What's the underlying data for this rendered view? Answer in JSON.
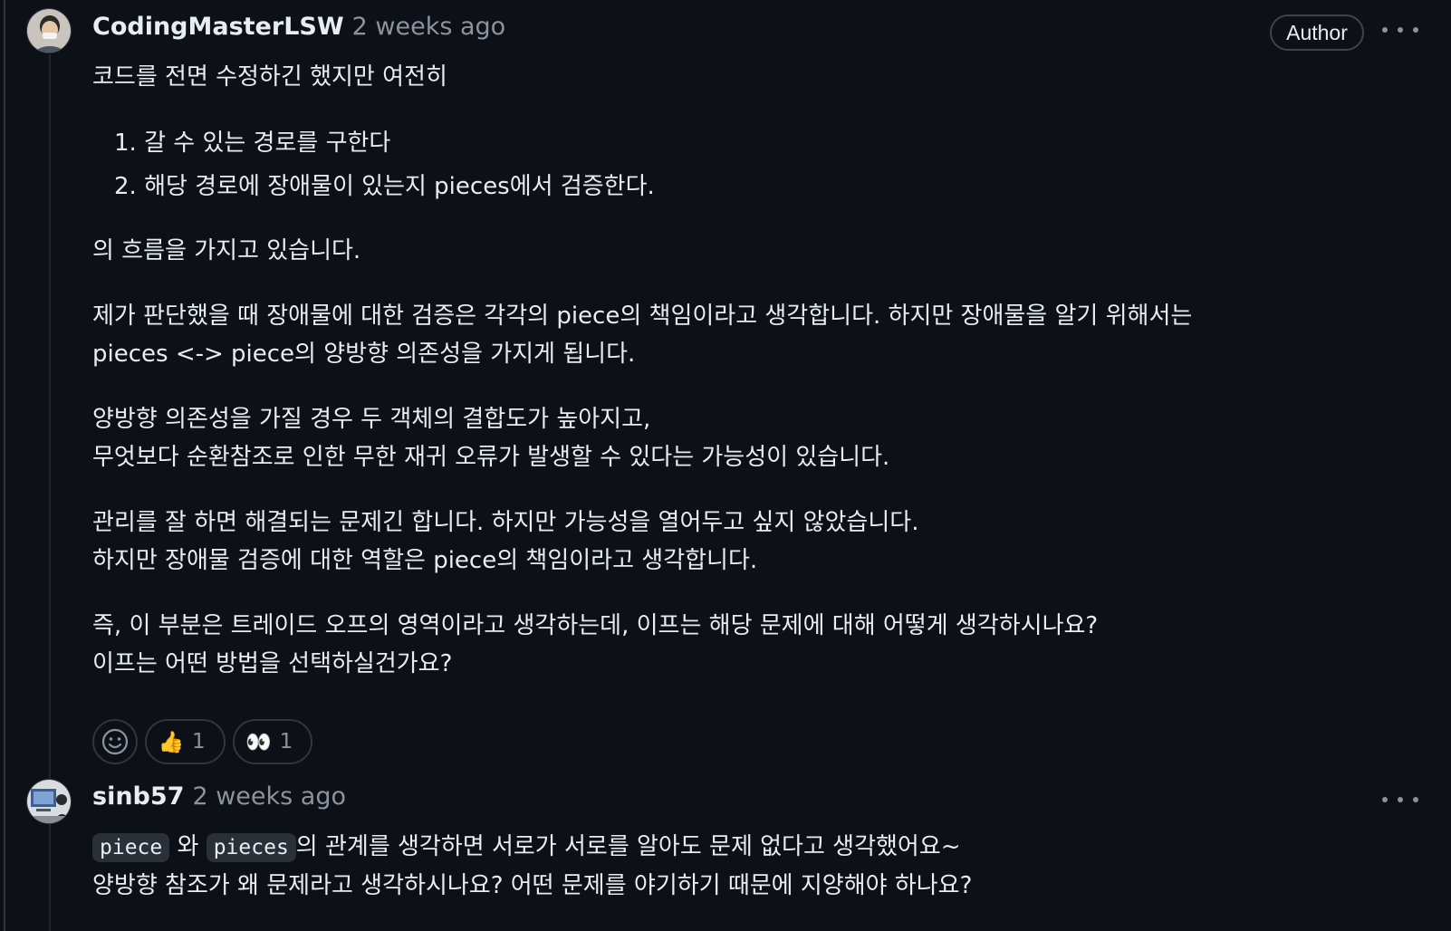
{
  "comments": [
    {
      "author": "CodingMasterLSW",
      "time": "2 weeks ago",
      "badge": "Author",
      "intro": "코드를 전면 수정하긴 했지만 여전히",
      "steps": [
        "1. 갈 수 있는 경로를 구한다",
        "2. 해당 경로에 장애물이 있는지 pieces에서 검증한다."
      ],
      "paragraphs": [
        [
          "의 흐름을 가지고 있습니다."
        ],
        [
          "제가 판단했을 때 장애물에 대한 검증은 각각의 piece의 책임이라고 생각합니다. 하지만 장애물을 알기 위해서는",
          "pieces <-> piece의 양방향 의존성을 가지게 됩니다."
        ],
        [
          "양방향 의존성을 가질 경우 두 객체의 결합도가 높아지고,",
          "무엇보다 순환참조로 인한 무한 재귀 오류가 발생할 수 있다는 가능성이 있습니다."
        ],
        [
          "관리를 잘 하면 해결되는 문제긴 합니다. 하지만 가능성을 열어두고 싶지 않았습니다.",
          "하지만 장애물 검증에 대한 역할은 piece의 책임이라고 생각합니다."
        ],
        [
          "즉, 이 부분은 트레이드 오프의 영역이라고 생각하는데, 이프는 해당 문제에 대해 어떻게 생각하시나요?",
          "이프는 어떤 방법을 선택하실건가요?"
        ]
      ],
      "reactions": [
        {
          "emoji": "👍",
          "icon": "thumbs-up-icon",
          "count": "1"
        },
        {
          "emoji": "👀",
          "icon": "eyes-icon",
          "count": "1"
        }
      ]
    },
    {
      "author": "sinb57",
      "time": "2 weeks ago",
      "code1": "piece",
      "text1": "와",
      "code2": "pieces",
      "text2": "의 관계를 생각하면 서로가 서로를 알아도 문제 없다고 생각했어요~",
      "line2": "양방향 참조가 왜 문제라고 생각하시나요? 어떤 문제를 야기하기 때문에 지양해야 하나요?"
    }
  ],
  "colors": {
    "background": "#0d1117",
    "text": "#e6edf3",
    "muted": "#8b949e",
    "border": "#30363d"
  }
}
